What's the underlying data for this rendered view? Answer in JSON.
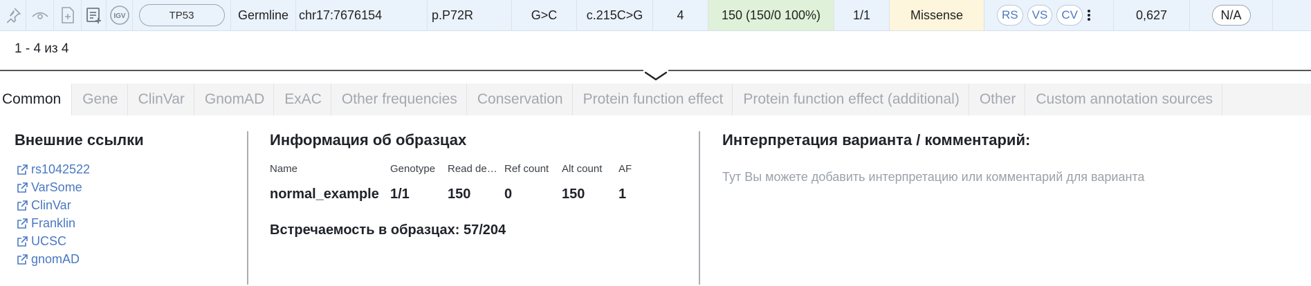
{
  "variant_row": {
    "icons": [
      "pin-icon",
      "eye-icon",
      "add-file-icon",
      "add-list-icon",
      "igv-icon"
    ],
    "igv_label": "IGV",
    "gene": "TP53",
    "origin": "Germline",
    "position": "chr17:7676154",
    "protein_change": "p.P72R",
    "nucleotide_change": "G>C",
    "cdna_change": "c.215C>G",
    "exon": "4",
    "depth": "150  (150/0 100%)",
    "genotype": "1/1",
    "effect": "Missense",
    "source_chips": [
      "RS",
      "VS",
      "CV"
    ],
    "score": "0,627",
    "classification": "N/A",
    "colors": {
      "depth_bg": "#dff1d8",
      "effect_bg": "#fdf5dc",
      "chip_text": "#4a78c2"
    }
  },
  "pagination": {
    "text": "1 - 4 из 4"
  },
  "tabs": [
    {
      "label": "Common",
      "active": true
    },
    {
      "label": "Gene",
      "active": false
    },
    {
      "label": "ClinVar",
      "active": false
    },
    {
      "label": "GnomAD",
      "active": false
    },
    {
      "label": "ExAC",
      "active": false
    },
    {
      "label": "Other frequencies",
      "active": false
    },
    {
      "label": "Conservation",
      "active": false
    },
    {
      "label": "Protein function effect",
      "active": false
    },
    {
      "label": "Protein function effect (additional)",
      "active": false
    },
    {
      "label": "Other",
      "active": false
    },
    {
      "label": "Custom annotation sources",
      "active": false
    }
  ],
  "external_links": {
    "title": "Внешние ссылки",
    "items": [
      "rs1042522",
      "VarSome",
      "ClinVar",
      "Franklin",
      "UCSC",
      "gnomAD"
    ]
  },
  "samples": {
    "title": "Информация об образцах",
    "headers": [
      "Name",
      "Genotype",
      "Read depth",
      "Ref count",
      "Alt count",
      "AF"
    ],
    "rows": [
      [
        "normal_example",
        "1/1",
        "150",
        "0",
        "150",
        "1"
      ]
    ],
    "occurrence": "Встречаемость в образцах: 57/204"
  },
  "interpretation": {
    "title": "Интерпретация варианта / комментарий:",
    "placeholder": "Тут Вы можете добавить интерпретацию или комментарий для варианта"
  }
}
